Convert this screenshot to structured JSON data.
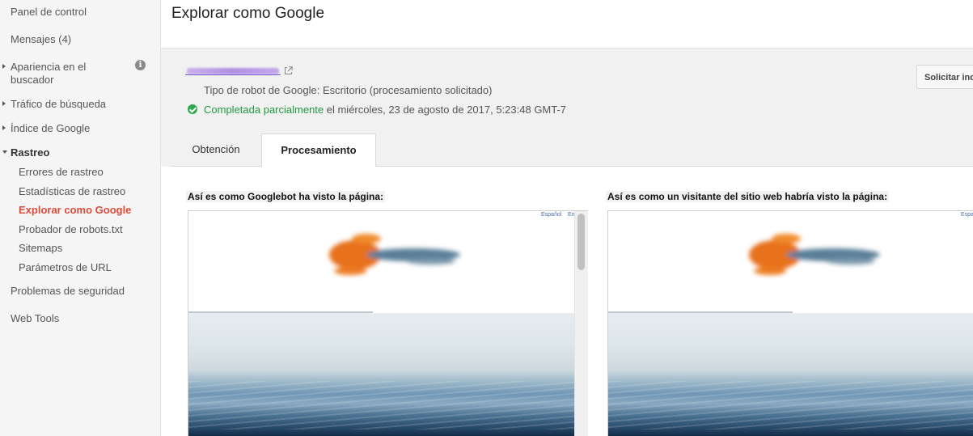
{
  "sidebar": {
    "items": [
      {
        "label": "Panel de control"
      },
      {
        "label": "Mensajes (4)"
      },
      {
        "label": "Apariencia en el buscador"
      },
      {
        "label": "Tráfico de búsqueda"
      },
      {
        "label": "Índice de Google"
      },
      {
        "label": "Rastreo"
      },
      {
        "label": "Problemas de seguridad"
      },
      {
        "label": "Web Tools"
      }
    ],
    "appearance_line1": "Apariencia en el",
    "appearance_line2": "buscador",
    "crawl_subitems": [
      {
        "label": "Errores de rastreo"
      },
      {
        "label": "Estadísticas de rastreo"
      },
      {
        "label": "Explorar como Google",
        "active": true
      },
      {
        "label": "Probador de robots.txt"
      },
      {
        "label": "Sitemaps"
      },
      {
        "label": "Parámetros de URL"
      }
    ],
    "info_icon": "i"
  },
  "header": {
    "title": "Explorar como Google"
  },
  "fetch_result": {
    "robot_type": "Tipo de robot de Google: Escritorio (procesamiento solicitado)",
    "status": "Completada parcialmente",
    "status_detail": " el miércoles, 23 de agosto de 2017, 5:23:48 GMT-7",
    "request_button": "Solicitar ind"
  },
  "tabs": [
    {
      "label": "Obtención",
      "active": false
    },
    {
      "label": "Procesamiento",
      "active": true
    }
  ],
  "previews": {
    "googlebot_caption": "Así es como Googlebot ha visto la página:",
    "visitor_caption": "Así es como un visitante del sitio web habría visto la página:",
    "lang_es": "Español",
    "lang_en_partial": "En"
  },
  "colors": {
    "active_link": "#dd4b39",
    "status_ok": "#1e9a3f",
    "logo_orange": "#e8711c",
    "logo_blue": "#5a7f98"
  },
  "icons": [
    "info-icon",
    "external-link-icon",
    "check-circle-icon"
  ]
}
